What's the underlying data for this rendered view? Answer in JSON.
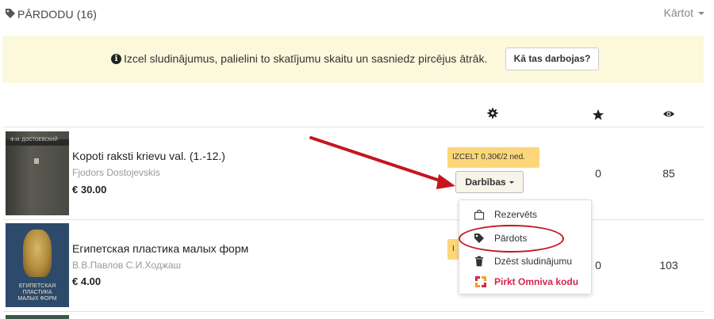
{
  "header": {
    "title": "PĀRDODU (16)",
    "sort_label": "Kārtot"
  },
  "promo": {
    "message": "Izcel sludinājumus, palielini to skatījumu skaitu un sasniedz pircējus ātrāk.",
    "button_label": "Kā tas darbojas?"
  },
  "columns": {
    "settings_icon": "gear-icon",
    "favorites_icon": "star-icon",
    "views_icon": "eye-icon"
  },
  "listings": [
    {
      "title": "Kopoti raksti krievu val. (1.-12.)",
      "author": "Fjodors Dostojevskis",
      "price": "€ 30.00",
      "cover_text": "Ф.М. ДОСТОЕВСКИЙ",
      "promote_label": "IZCELT 0,30€/2 ned.",
      "actions_label": "Darbības",
      "favorites": "0",
      "views": "85"
    },
    {
      "title": "Египетская пластика малых форм",
      "author": "В.В.Павлов С.И.Ходжаш",
      "price": "€ 4.00",
      "cover_lines": [
        "ЕГИПЕТСКАЯ",
        "ПЛАСТИКА",
        "МАЛЫХ ФОРМ"
      ],
      "promote_label": "I",
      "favorites": "0",
      "views": "103"
    }
  ],
  "actions_menu": {
    "items": [
      {
        "label": "Rezervēts",
        "icon": "shopping-bag-icon"
      },
      {
        "label": "Pārdots",
        "icon": "tag-icon"
      },
      {
        "label": "Dzēst sludinājumu",
        "icon": "trash-icon"
      },
      {
        "label": "Pirkt Omniva kodu",
        "icon": "omniva-logo-icon"
      }
    ]
  },
  "colors": {
    "promo_bg": "#fcf8dc",
    "promote_badge": "#fcd77a",
    "annotation_red": "#c4161c",
    "omniva_red": "#d6254b"
  }
}
